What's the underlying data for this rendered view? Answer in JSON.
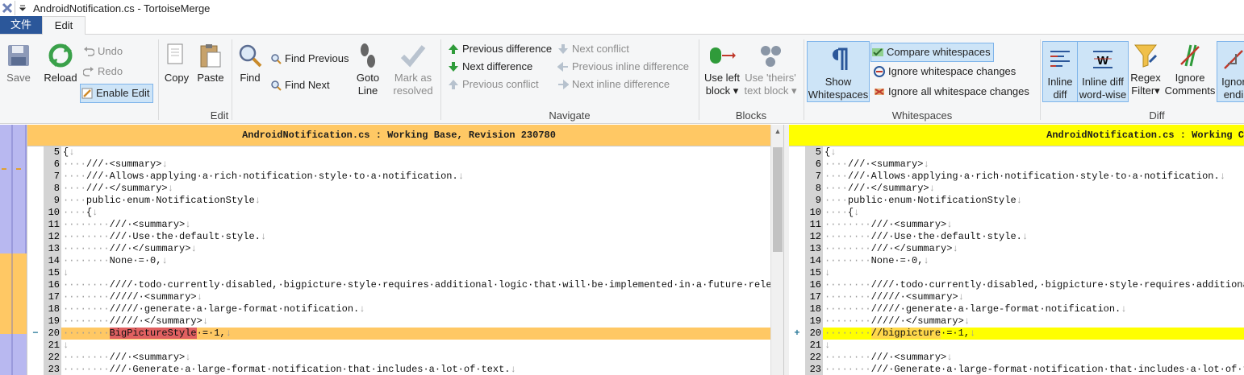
{
  "window": {
    "title": "AndroidNotification.cs - TortoiseMerge"
  },
  "tabs": {
    "file": "文件",
    "edit": "Edit"
  },
  "edit_group": {
    "label": "Edit",
    "save": "Save",
    "reload": "Reload",
    "undo": "Undo",
    "redo": "Redo",
    "enable_edit": "Enable Edit",
    "copy": "Copy",
    "paste": "Paste",
    "find": "Find",
    "find_previous": "Find Previous",
    "find_next": "Find Next",
    "goto_line_1": "Goto",
    "goto_line_2": "Line",
    "mark_resolved_1": "Mark as",
    "mark_resolved_2": "resolved"
  },
  "navigate_group": {
    "label": "Navigate",
    "prev_diff": "Previous difference",
    "next_diff": "Next difference",
    "prev_conflict": "Previous conflict",
    "next_conflict": "Next conflict",
    "prev_inline": "Previous inline difference",
    "next_inline": "Next inline difference"
  },
  "blocks_group": {
    "label": "Blocks",
    "use_left_1": "Use left",
    "use_left_2": "block",
    "use_theirs_1": "Use 'theirs'",
    "use_theirs_2": "text block"
  },
  "whitespaces_group": {
    "label": "Whitespaces",
    "show_ws_1": "Show",
    "show_ws_2": "Whitespaces",
    "compare_ws": "Compare whitespaces",
    "ignore_ws_changes": "Ignore whitespace changes",
    "ignore_all_ws": "Ignore all whitespace changes"
  },
  "diff_group": {
    "label": "Diff",
    "inline_diff_1": "Inline",
    "inline_diff_2": "diff",
    "inline_ww_1": "Inline diff",
    "inline_ww_2": "word-wise",
    "regex_1": "Regex",
    "regex_2": "Filter",
    "ignore_comments_1": "Ignore",
    "ignore_comments_2": "Comments",
    "ignore_endings_1": "Ignor",
    "ignore_endings_2": "endi"
  },
  "left_pane": {
    "header": "AndroidNotification.cs : Working Base, Revision 230780"
  },
  "right_pane": {
    "header": "AndroidNotification.cs : Working C"
  },
  "colors": {
    "accent": "#2b579a",
    "left_header": "#ffc864",
    "right_header": "#ffff00",
    "removed_word": "#e06060"
  },
  "lines": [
    {
      "n": "5",
      "indent": "",
      "text": "{"
    },
    {
      "n": "6",
      "indent": "····",
      "text": "///·<summary>"
    },
    {
      "n": "7",
      "indent": "····",
      "text": "///·Allows·applying·a·rich·notification·style·to·a·notification."
    },
    {
      "n": "8",
      "indent": "····",
      "text": "///·</summary>"
    },
    {
      "n": "9",
      "indent": "····",
      "text": "public·enum·NotificationStyle"
    },
    {
      "n": "10",
      "indent": "····",
      "text": "{"
    },
    {
      "n": "11",
      "indent": "········",
      "text": "///·<summary>"
    },
    {
      "n": "12",
      "indent": "········",
      "text": "///·Use·the·default·style."
    },
    {
      "n": "13",
      "indent": "········",
      "text": "///·</summary>"
    },
    {
      "n": "14",
      "indent": "········",
      "text": "None·=·0,"
    },
    {
      "n": "15",
      "indent": "",
      "text": ""
    },
    {
      "n": "16",
      "indent": "········",
      "text": "////·todo·currently·disabled,·bigpicture·style·requires·additional·logic·that·will·be·implemented·in·a·future·release"
    },
    {
      "n": "17",
      "indent": "········",
      "text": "/////·<summary>"
    },
    {
      "n": "18",
      "indent": "········",
      "text": "/////·generate·a·large-format·notification."
    },
    {
      "n": "19",
      "indent": "········",
      "text": "/////·</summary>"
    },
    {
      "n": "20",
      "indent": "········",
      "text": "",
      "changed": true
    },
    {
      "n": "21",
      "indent": "",
      "text": ""
    },
    {
      "n": "22",
      "indent": "········",
      "text": "///·<summary>"
    },
    {
      "n": "23",
      "indent": "········",
      "text": "///·Generate·a·large-format·notification·that·includes·a·lot·of·text."
    }
  ],
  "line20": {
    "left_marker": "−",
    "left_word": "BigPictureStyle",
    "left_rest": "·=·1,",
    "right_marker": "+",
    "right_word": "//bigpicture",
    "right_rest": "·=·1,"
  },
  "eol": "↓"
}
